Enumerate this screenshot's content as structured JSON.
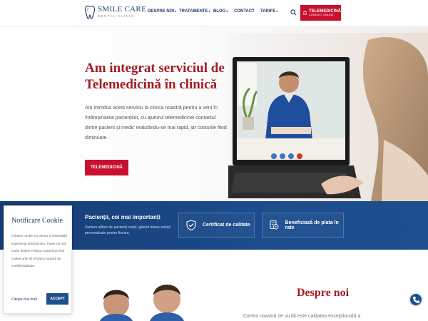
{
  "brand": {
    "name": "SMILE CARE",
    "tagline": "DENTAL CLINIC"
  },
  "nav": {
    "items": [
      {
        "label": "DESPRE NOI",
        "dropdown": true
      },
      {
        "label": "TRATAMENTE",
        "dropdown": true
      },
      {
        "label": "BLOG",
        "dropdown": true
      },
      {
        "label": "CONTACT",
        "dropdown": false
      },
      {
        "label": "TARIFE",
        "dropdown": true
      }
    ],
    "search_icon": "search-icon",
    "telemed_button": {
      "label": "TELEMEDICINĂ",
      "sublabel": "CONSULT ONLINE",
      "icon": "medkit-icon"
    }
  },
  "hero": {
    "title": "Am integrat serviciul de Telemedicină în clinică",
    "text": "Am introdus acest serviciu la clinica noastră pentru a veni în întâmpinarea pacienților, cu ajutorul telemedicinei contactul dintre pacient și medic realizându-se mai rapid, iar costurile fiind diminuate.",
    "cta": "TELEMEDICINĂ"
  },
  "band": {
    "title": "Pacienții, cei mai importanți",
    "text": "Suntem alături de pacienții noștri, găsind mereu soluții personalizate pentru fiecare.",
    "features": [
      {
        "label": "Certificat de calitate",
        "icon": "shield-check-icon"
      },
      {
        "label": "Beneficiază de plata în rate",
        "icon": "payment-icon"
      }
    ]
  },
  "about": {
    "title": "Despre noi",
    "text": "Cartea noastră de vizită este calitatea excepțională a"
  },
  "cookie": {
    "title": "Notificare Cookie",
    "text": "Folosim cookie uri pentru a îmbunătăți experiența utilizatorului. Puteți citi mai multe despre Politica noastră privind cookie urile din Politica noastră de confidențialitate.",
    "more": "Citește mai mult",
    "accept": "ACCEPT"
  },
  "colors": {
    "accent_red": "#c8102e",
    "brand_blue": "#1d4f8f",
    "title_red": "#a31d24"
  }
}
